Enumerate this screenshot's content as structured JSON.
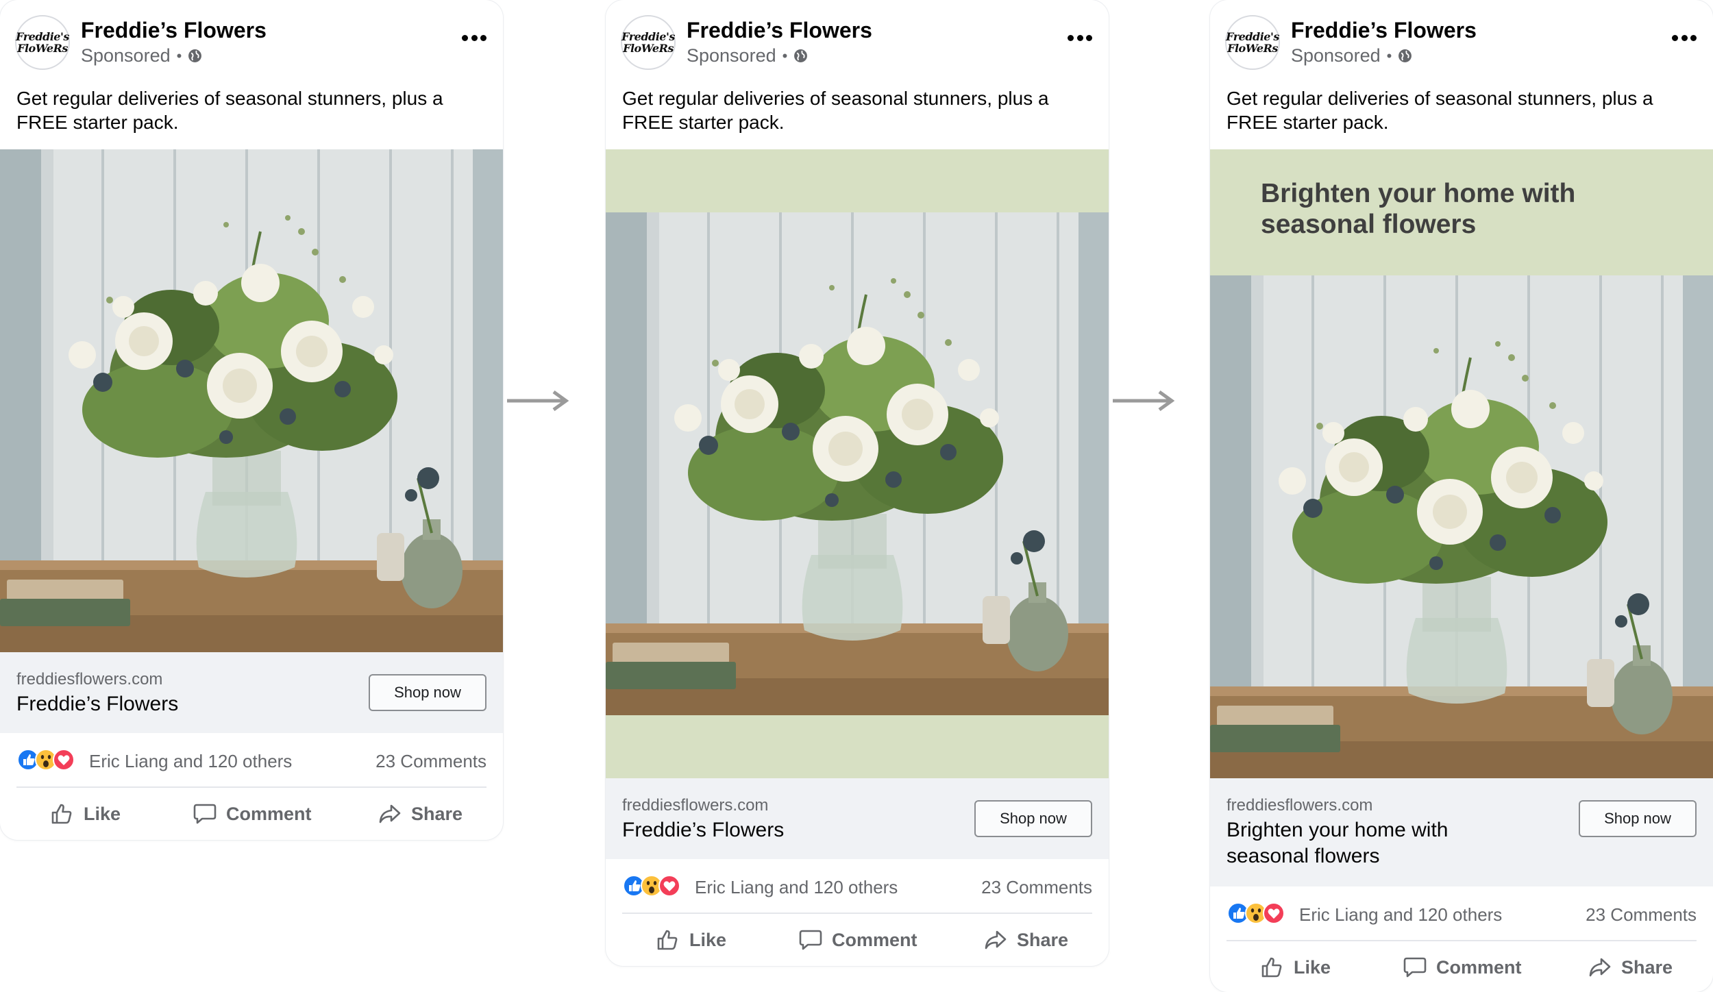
{
  "ad": {
    "page_name": "Freddie’s Flowers",
    "logo_line1": "Freddie's",
    "logo_line2": "FloWeRs",
    "sponsored": "Sponsored",
    "dot": "•",
    "caption_line1": "Get regular deliveries of seasonal stunners, plus a",
    "caption_line2": "FREE starter pack.",
    "domain": "freddiesflowers.com",
    "cta": "Shop now",
    "reactors": "Eric Liang and 120 others",
    "comments": "23 Comments",
    "like": "Like",
    "comment": "Comment",
    "share": "Share"
  },
  "variants": [
    {
      "link_title_line1": "Freddie’s Flowers",
      "link_title_line2": ""
    },
    {
      "link_title_line1": "Freddie’s Flowers",
      "link_title_line2": ""
    },
    {
      "band_headline_line1": "Brighten your home with",
      "band_headline_line2": "seasonal flowers",
      "link_title_line1": "Brighten your home with",
      "link_title_line2": "seasonal flowers"
    }
  ],
  "colors": {
    "band_green": "#d7e0c3",
    "like_blue": "#1877f2",
    "love_red": "#f33e58",
    "wow_yellow": "#fcc03c",
    "arrow_gray": "#9a9a9a"
  },
  "icons": [
    "globe-icon",
    "more-icon",
    "like-reaction-icon",
    "wow-reaction-icon",
    "love-reaction-icon",
    "thumbs-up-icon",
    "comment-icon",
    "share-icon",
    "arrow-right-icon"
  ]
}
